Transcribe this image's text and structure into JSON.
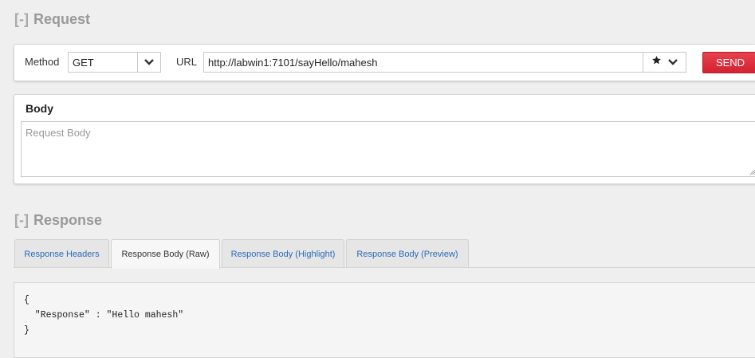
{
  "request": {
    "section_toggle": "[-]",
    "section_title": "Request",
    "method_label": "Method",
    "method_value": "GET",
    "url_label": "URL",
    "url_value": "http://labwin1:7101/sayHello/mahesh",
    "send_label": "SEND"
  },
  "body": {
    "title": "Body",
    "placeholder": "Request Body"
  },
  "response": {
    "section_toggle": "[-]",
    "section_title": "Response",
    "tabs": [
      {
        "label": "Response Headers",
        "active": false
      },
      {
        "label": "Response Body (Raw)",
        "active": true
      },
      {
        "label": "Response Body (Highlight)",
        "active": false
      },
      {
        "label": "Response Body (Preview)",
        "active": false
      }
    ],
    "raw_body": "{\n  \"Response\" : \"Hello mahesh\"\n}"
  },
  "colors": {
    "send_button": "#d42232",
    "tab_link": "#2a6ab8"
  },
  "icons": {
    "method_dropdown": "chevron-down-icon",
    "favorite": "star-icon",
    "url_dropdown": "chevron-down-icon"
  }
}
